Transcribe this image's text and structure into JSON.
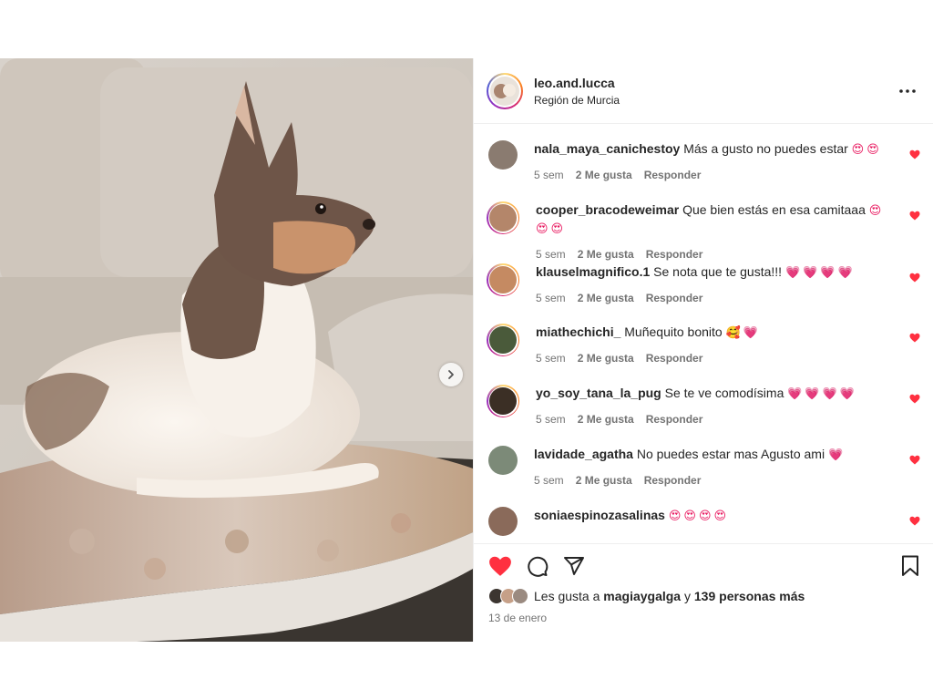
{
  "post": {
    "author": {
      "username": "leo.and.lucca",
      "location": "Región de Murcia"
    },
    "comments": [
      {
        "user": "nala_maya_canichestoy",
        "text": "Más a gusto no puedes estar",
        "emoji": "😍😍",
        "age": "5 sem",
        "likes": "2 Me gusta",
        "reply": "Responder",
        "story": false,
        "avatar_color": "#8a7b70"
      },
      {
        "user": "cooper_bracodeweimar",
        "text": "Que bien estás en esa camitaaa",
        "emoji": "😍😍😍",
        "age": "5 sem",
        "likes": "2 Me gusta",
        "reply": "Responder",
        "story": true,
        "avatar_color": "#b4866a"
      },
      {
        "user": "klauselmagnifico.1",
        "text": "Se nota que te gusta!!!",
        "emoji": "💗💗💗💗",
        "age": "5 sem",
        "likes": "2 Me gusta",
        "reply": "Responder",
        "story": true,
        "avatar_color": "#c58a62"
      },
      {
        "user": "miathechichi_",
        "text": "Muñequito bonito",
        "emoji": "🥰💗",
        "age": "5 sem",
        "likes": "2 Me gusta",
        "reply": "Responder",
        "story": true,
        "avatar_color": "#4a5a3a"
      },
      {
        "user": "yo_soy_tana_la_pug",
        "text": "Se te ve comodísima",
        "emoji": "💗💗💗💗",
        "age": "5 sem",
        "likes": "2 Me gusta",
        "reply": "Responder",
        "story": true,
        "avatar_color": "#3b2f25"
      },
      {
        "user": "lavidade_agatha",
        "text": "No puedes estar mas Agusto ami",
        "emoji": "💗",
        "age": "5 sem",
        "likes": "2 Me gusta",
        "reply": "Responder",
        "story": false,
        "avatar_color": "#7c8a78"
      },
      {
        "user": "soniaespinozasalinas",
        "text": "",
        "emoji": "😍😍😍😍",
        "age": "",
        "likes": "",
        "reply": "",
        "story": false,
        "avatar_color": "#8a6a5a"
      }
    ],
    "likes": {
      "prefix": "Les gusta a",
      "user": "magiaygalga",
      "connector": "y",
      "others": "139 personas más"
    },
    "date": "13 de enero",
    "colors": {
      "heart": "#ff3040",
      "text": "#262626",
      "muted": "#737373",
      "border": "#efefef"
    },
    "icons": [
      "more-icon",
      "heart-icon",
      "comment-icon",
      "share-icon",
      "bookmark-icon",
      "chevron-right-icon"
    ]
  }
}
